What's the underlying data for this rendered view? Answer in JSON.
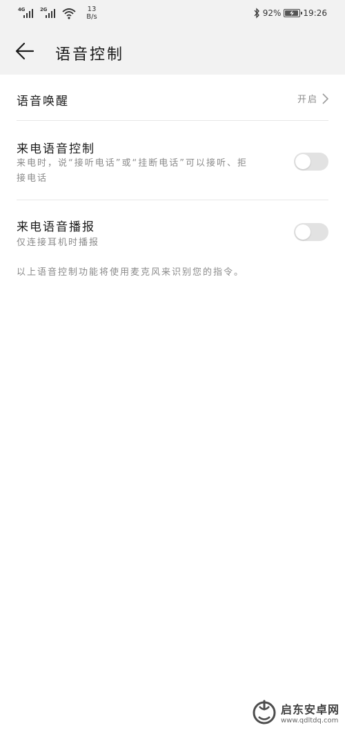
{
  "status_bar": {
    "sim1_type": "4G",
    "sim2_type": "2G",
    "net_speed_value": "13",
    "net_speed_unit": "B/s",
    "battery_percent": "92%",
    "time": "19:26"
  },
  "header": {
    "title": "语音控制"
  },
  "settings": {
    "voice_wakeup": {
      "label": "语音唤醒",
      "value": "开启"
    },
    "call_voice_control": {
      "label": "来电语音控制",
      "description": "来电时，说“接听电话”或“挂断电话”可以接听、拒接电话",
      "enabled": false
    },
    "call_voice_announce": {
      "label": "来电语音播报",
      "description": "仅连接耳机时播报",
      "enabled": false
    }
  },
  "footnote": "以上语音控制功能将使用麦克风来识别您的指令。",
  "watermark": {
    "name": "启东安卓网",
    "url": "www.qdltdq.com"
  },
  "colors": {
    "header_bg": "#f2f2f2",
    "toggle_off": "#e2e2e2",
    "secondary_text": "#8a8a8a"
  }
}
